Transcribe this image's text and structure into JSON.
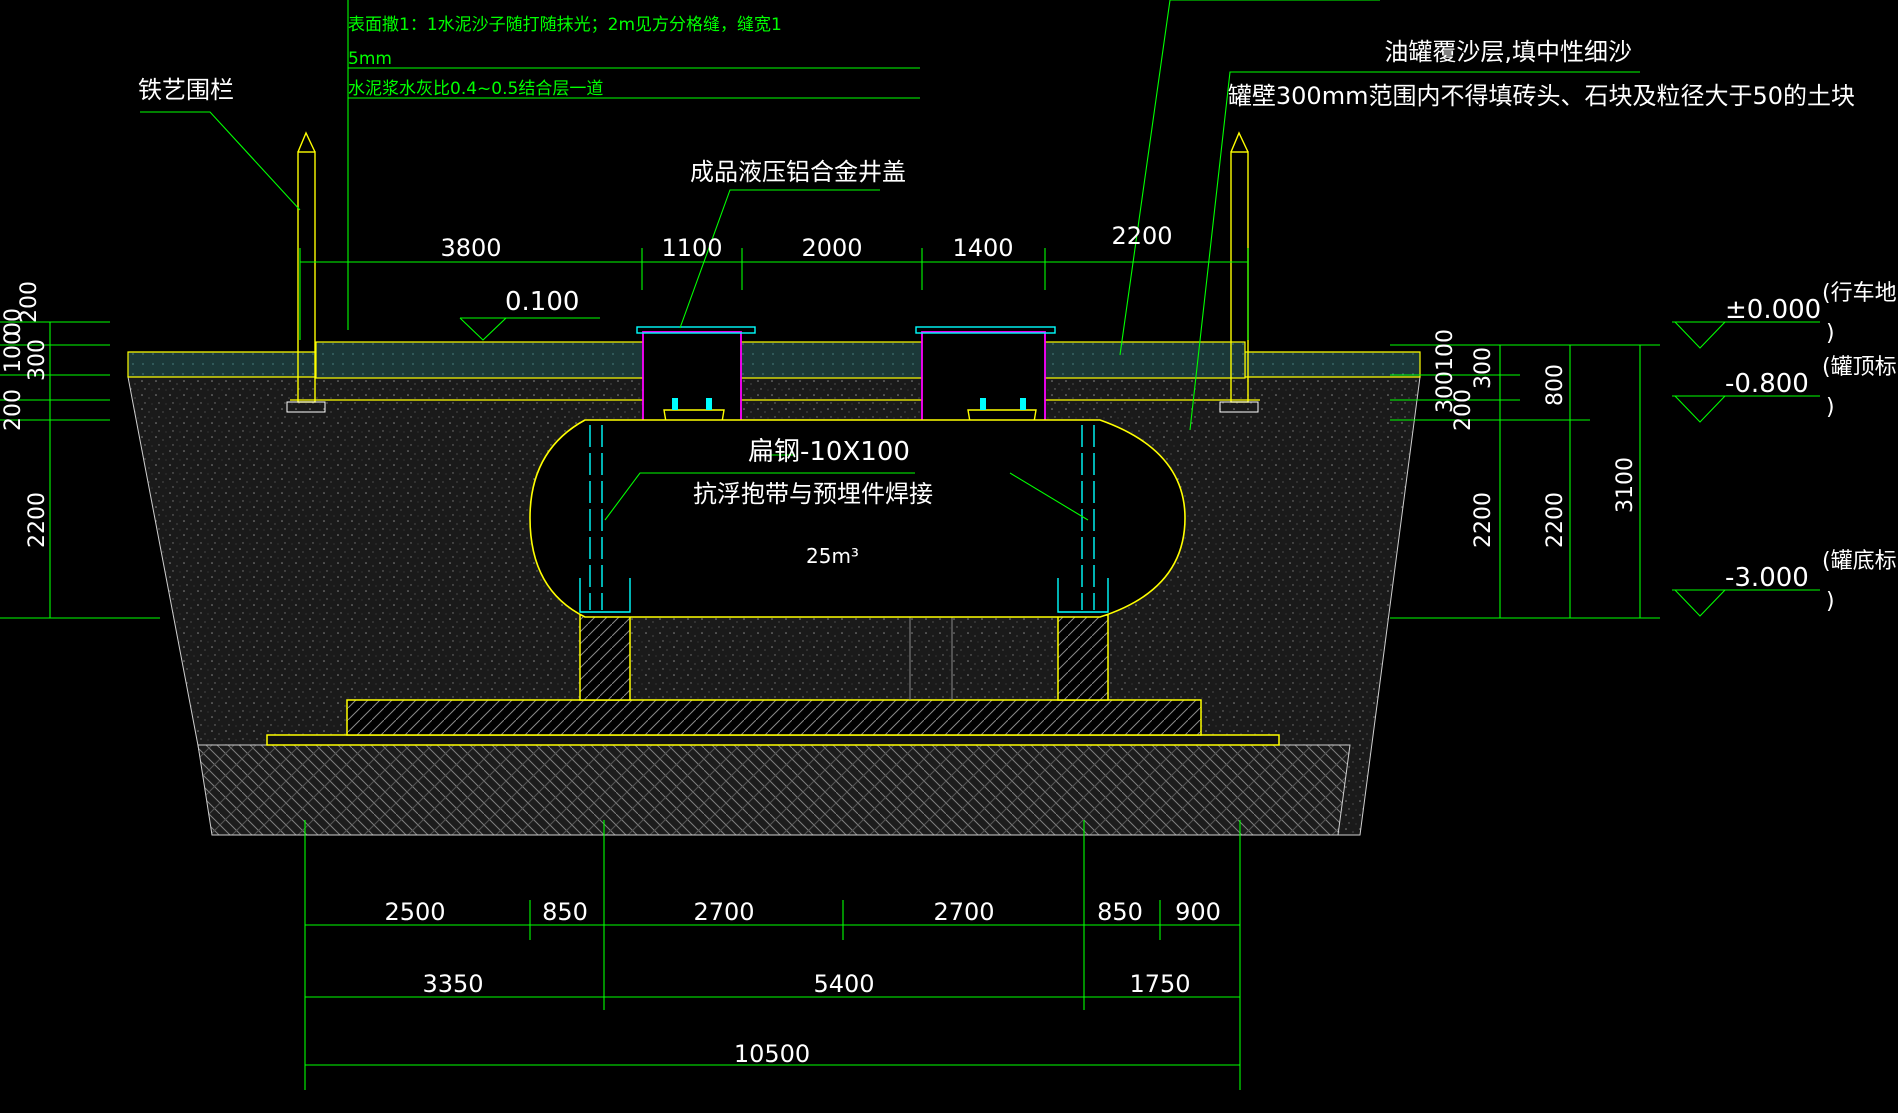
{
  "notes": {
    "note_1": "表面撒1：1水泥沙子随打随抹光；2m见方分格缝，缝宽1",
    "note_2": "5mm",
    "note_3": "水泥浆水灰比0.4~0.5结合层一道"
  },
  "labels": {
    "fence": "铁艺围栏",
    "manhole_cover": "成品液压铝合金井盖",
    "sand_layer": "油罐覆沙层,填中性细沙",
    "backfill_rule": "罐壁300mm范围内不得填砖头、石块及粒径大于50的土块",
    "flat_steel": "扁钢-10X100",
    "anti_float": "抗浮抱带与预埋件焊接",
    "tank_volume": "25m³",
    "level_0100": "0.100"
  },
  "elevations": [
    {
      "value": "±0.000",
      "note": "(行车地",
      "close": ")"
    },
    {
      "value": "-0.800",
      "note": "(罐顶标",
      "close": ")"
    },
    {
      "value": "-3.000",
      "note": "(罐底标",
      "close": ")"
    }
  ],
  "dims_top": [
    "3800",
    "1100",
    "2000",
    "1400",
    "2200"
  ],
  "dims_bottom_1": [
    "2500",
    "850",
    "2700",
    "2700",
    "850",
    "900"
  ],
  "dims_bottom_2": [
    "3350",
    "5400",
    "1750"
  ],
  "dims_total": "10500",
  "dims_left": [
    "200",
    "300",
    "200",
    "2200",
    "100",
    "00"
  ],
  "dims_right_a": [
    "100",
    "300",
    "200",
    "2200",
    "300"
  ],
  "dims_right_b": [
    "800",
    "2200"
  ],
  "dims_right_c": "3100",
  "colors": {
    "background": "#000000",
    "dimension": "#00ff00",
    "outline": "#ffff00",
    "text": "#ffffff",
    "cover": "#ff00ff",
    "rebar": "#00ffff"
  }
}
